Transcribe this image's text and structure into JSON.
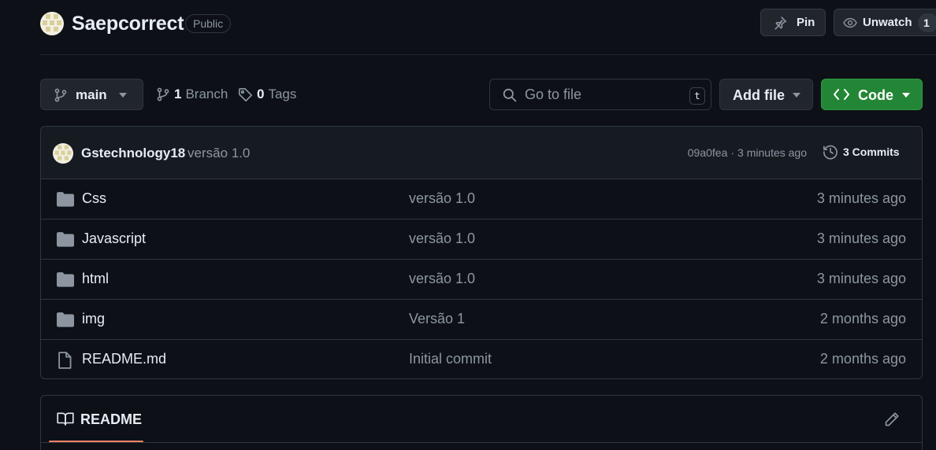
{
  "repo": {
    "name": "Saepcorrect",
    "visibility": "Public",
    "pin_label": "Pin",
    "watch_label": "Unwatch",
    "watch_count": "1"
  },
  "toolbar": {
    "branch": "main",
    "branch_count": "1",
    "branch_label": "Branch",
    "tag_count": "0",
    "tag_label": "Tags",
    "search_placeholder": "Go to file",
    "search_shortcut": "t",
    "add_file_label": "Add file",
    "code_label": "Code"
  },
  "latest_commit": {
    "author": "Gstechnology18",
    "message": "versão 1.0",
    "hash": "09a0fea",
    "separator": "·",
    "time": "3 minutes ago",
    "commits_label": "3 Commits"
  },
  "files": [
    {
      "type": "folder",
      "name": "Css",
      "message": "versão 1.0",
      "date": "3 minutes ago"
    },
    {
      "type": "folder",
      "name": "Javascript",
      "message": "versão 1.0",
      "date": "3 minutes ago"
    },
    {
      "type": "folder",
      "name": "html",
      "message": "versão 1.0",
      "date": "3 minutes ago"
    },
    {
      "type": "folder",
      "name": "img",
      "message": "Versão 1",
      "date": "2 months ago"
    },
    {
      "type": "file",
      "name": "README.md",
      "message": "Initial commit",
      "date": "2 months ago"
    }
  ],
  "readme": {
    "tab_label": "README"
  },
  "icons": {
    "folder": "folder-icon",
    "file": "file-icon"
  },
  "colors": {
    "background": "#0d1117",
    "code_button": "#238636",
    "readme_underline": "#f78166",
    "muted_text": "#8d96a0"
  }
}
